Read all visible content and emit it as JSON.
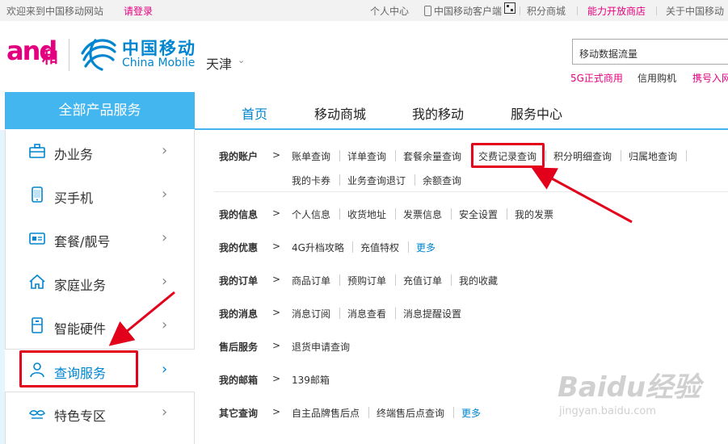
{
  "topbar": {
    "welcome": "欢迎来到中国移动网站",
    "login": "请登录",
    "personal_center": "个人中心",
    "client": "中国移动客户端",
    "points_mall": "积分商城",
    "open_store": "能力开放商店",
    "about": "关于中国移动"
  },
  "header": {
    "logo_and": "and",
    "logo_he": "和",
    "brand_zh": "中国移动",
    "brand_en": "China Mobile",
    "city": "天津",
    "search_value": "移动数据流量",
    "hotlinks": [
      "5G正式商用",
      "信用购机",
      "携号入网"
    ]
  },
  "nav": {
    "all_products": "全部产品服务",
    "tabs": [
      "首页",
      "移动商城",
      "我的移动",
      "服务中心"
    ]
  },
  "sidebar": {
    "items": [
      {
        "label": "办业务",
        "icon": "briefcase-icon"
      },
      {
        "label": "买手机",
        "icon": "phone-icon"
      },
      {
        "label": "套餐/靓号",
        "icon": "sim-card-icon"
      },
      {
        "label": "家庭业务",
        "icon": "house-icon"
      },
      {
        "label": "智能硬件",
        "icon": "device-icon"
      },
      {
        "label": "查询服务",
        "icon": "user-icon"
      },
      {
        "label": "特色专区",
        "icon": "mustache-icon"
      }
    ]
  },
  "content": {
    "arrow": ">",
    "rows": [
      {
        "label": "我的账户",
        "links": [
          "账单查询",
          "详单查询",
          "套餐余量查询",
          "交费记录查询",
          "积分明细查询",
          "归属地查询",
          "我的卡券",
          "业务查询退订",
          "余额查询"
        ]
      },
      {
        "label": "我的信息",
        "links": [
          "个人信息",
          "收货地址",
          "发票信息",
          "安全设置",
          "我的发票"
        ]
      },
      {
        "label": "我的优惠",
        "links": [
          "4G升档攻略",
          "充值特权",
          "更多"
        ]
      },
      {
        "label": "我的订单",
        "links": [
          "商品订单",
          "预购订单",
          "充值订单",
          "我的收藏"
        ]
      },
      {
        "label": "我的消息",
        "links": [
          "消息订阅",
          "消息查看",
          "消息提醒设置"
        ]
      },
      {
        "label": "售后服务",
        "links": [
          "退货申请查询"
        ]
      },
      {
        "label": "我的邮箱",
        "links": [
          "139邮箱"
        ]
      },
      {
        "label": "其它查询",
        "links": [
          "自主品牌售后点",
          "终端售后点查询",
          "更多"
        ]
      }
    ]
  },
  "watermark": {
    "big": "Baidu经验",
    "small": "jingyan.baidu.com"
  },
  "colors": {
    "brand_blue": "#0085d0",
    "nav_blue": "#43b5ef",
    "brand_pink": "#e3007f",
    "annotation_red": "#e3001b"
  }
}
